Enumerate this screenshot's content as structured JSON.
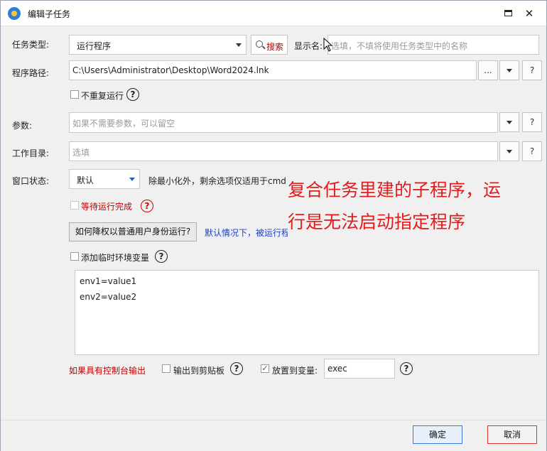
{
  "window": {
    "title": "编辑子任务",
    "maximize_icon": "maximize-icon",
    "close_glyph": "✕"
  },
  "task_type": {
    "label": "任务类型:",
    "value": "运行程序"
  },
  "search_button": {
    "label": "搜索"
  },
  "display_name": {
    "label": "显示名:",
    "placeholder": "选填，不填将使用任务类型中的名称"
  },
  "program_path": {
    "label": "程序路径:",
    "value": "C:\\Users\\Administrator\\Desktop\\Word2024.lnk",
    "browse_label": "...",
    "help_label": "?"
  },
  "no_repeat": {
    "label": "不重复运行",
    "checked": false
  },
  "params": {
    "label": "参数:",
    "placeholder": "如果不需要参数，可以留空",
    "help_label": "?"
  },
  "workdir": {
    "label": "工作目录:",
    "placeholder": "选填",
    "help_label": "?"
  },
  "window_state": {
    "label": "窗口状态:",
    "value": "默认",
    "hint": "除最小化外，剩余选项仅适用于cmd"
  },
  "wait_complete": {
    "label": "等待运行完成",
    "checked": false
  },
  "downgrade": {
    "button_label": "如何降权以普通用户身份运行?",
    "hint": "默认情况下，被运行程"
  },
  "temp_env": {
    "label": "添加临时环境变量",
    "checked": false,
    "lines": [
      "env1=value1",
      "env2=value2"
    ]
  },
  "console_output": {
    "label": "如果具有控制台输出"
  },
  "clipboard": {
    "label": "输出到剪贴板",
    "checked": false
  },
  "to_variable": {
    "label": "放置到变量:",
    "checked": true,
    "value": "exec"
  },
  "footer": {
    "ok_label": "确定",
    "cancel_label": "取消"
  },
  "annotation": {
    "line1": "复合任务里建的子程序，运",
    "line2": "行是无法启动指定程序"
  },
  "colors": {
    "accent_red": "#e51c1c",
    "link_blue": "#1c3fc7",
    "ok_border": "#3b78d8"
  }
}
